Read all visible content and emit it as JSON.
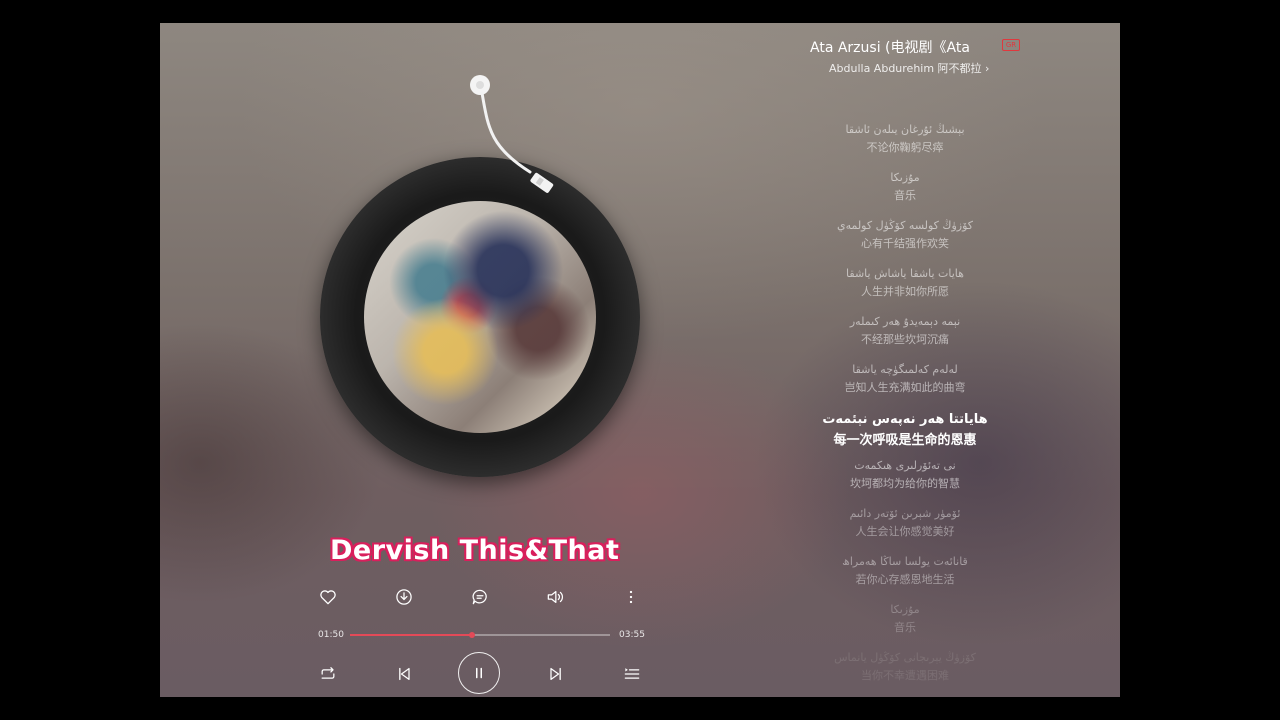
{
  "song": {
    "title": "Ata Arzusi (电视剧《Ata",
    "badge": "GR",
    "artist": "Abdulla Abdurehim 阿不都拉 ›"
  },
  "lyrics": [
    {
      "ug": "بېشىڭ ئۇرغان يىلەن ئاشقا",
      "zh": "不论你鞠躬尽瘁"
    },
    {
      "ug": "مۇزىكا",
      "zh": "音乐"
    },
    {
      "ug": "كۆزۈڭ كولسە كۆڭۈل كولمەي",
      "zh": "心有千结强作欢笑"
    },
    {
      "ug": "ھايات ياشقا ياشاش ياشقا",
      "zh": "人生并非如你所愿"
    },
    {
      "ug": "نېمە دېمەيدۇ ھەر كىملەر",
      "zh": "不经那些坎坷沉痛"
    },
    {
      "ug": "لەلەم كەلمىگۈچە ياشقا",
      "zh": "岂知人生充满如此的曲弯"
    },
    {
      "ug": "ھاياتتا ھەر نەپەس نېئمەت",
      "zh": "每一次呼吸是生命的恩惠"
    },
    {
      "ug": "نى تەئۆرلىرى ھىكمەت",
      "zh": "坎坷都均为给你的智慧"
    },
    {
      "ug": "ئۆمۈر شېرىن ئۆتەر دائىم",
      "zh": "人生会让你感觉美好"
    },
    {
      "ug": "قانائەت يولسا ساڭا ھەمراھ",
      "zh": "若你心存感恩地生活"
    },
    {
      "ug": "مۇزىكا",
      "zh": "音乐"
    },
    {
      "ug": "كۆزۈڭ يېرىجانى كۆڭۈل يانماس",
      "zh": "当你不幸遭遇困难"
    }
  ],
  "watermark": "Dervish This&That",
  "player": {
    "elapsed": "01:50",
    "duration": "03:55",
    "progress": 0.47
  },
  "colors": {
    "accent": "#e34a58",
    "watermark_outline": "#d91f5c"
  },
  "icons": {
    "actions": [
      "heart-icon",
      "download-icon",
      "comment-icon",
      "sound-effect-icon",
      "more-icon"
    ],
    "controls": [
      "repeat-icon",
      "previous-icon",
      "pause-icon",
      "next-icon",
      "playlist-icon"
    ]
  }
}
